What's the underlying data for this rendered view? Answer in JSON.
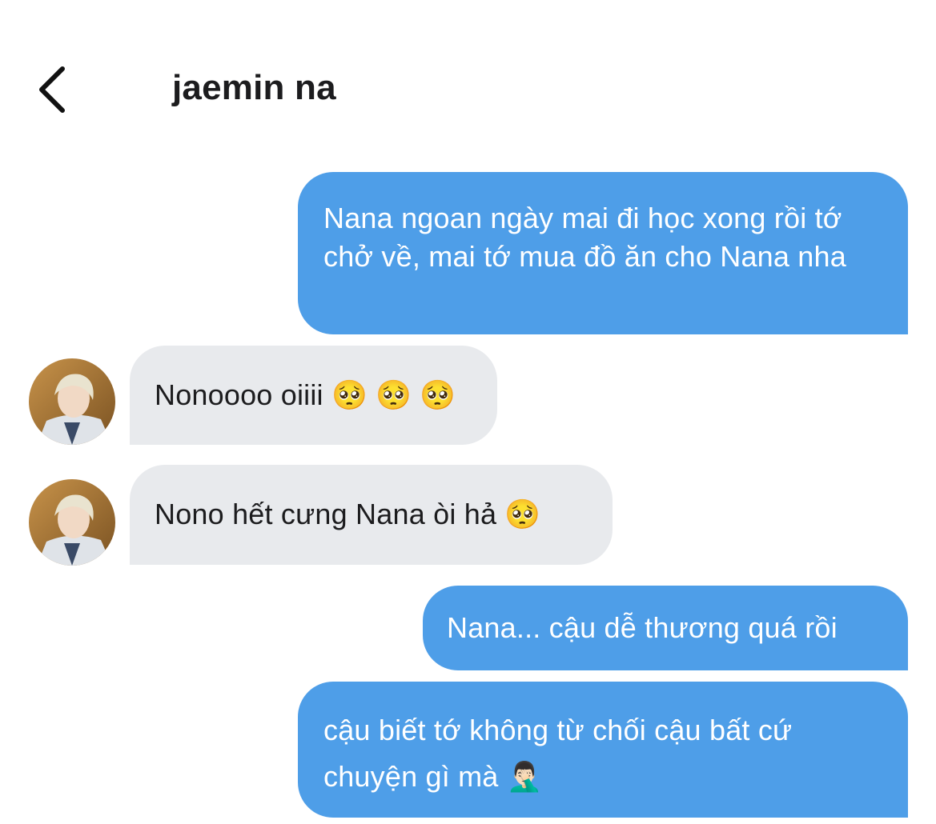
{
  "header": {
    "back_icon": "chevron-left-icon",
    "title": "jaemin na"
  },
  "messages": [
    {
      "side": "sent",
      "text": "Nana ngoan ngày mai đi học xong rồi tớ chở về, mai tớ mua đồ ăn cho Nana nha"
    },
    {
      "side": "received",
      "text": "Nonoooo oiiii 🥺 🥺 🥺"
    },
    {
      "side": "received",
      "text": "Nono hết cưng Nana òi hả 🥺"
    },
    {
      "side": "sent",
      "text": "Nana... cậu dễ thương quá rồi"
    },
    {
      "side": "sent",
      "text": "cậu biết tớ không từ chối cậu bất cứ chuyện gì mà 🤦🏻‍♂️"
    }
  ],
  "colors": {
    "sent_bubble": "#4e9ee8",
    "received_bubble": "#e8eaed",
    "sent_text": "#ffffff",
    "received_text": "#1c1c1e"
  }
}
